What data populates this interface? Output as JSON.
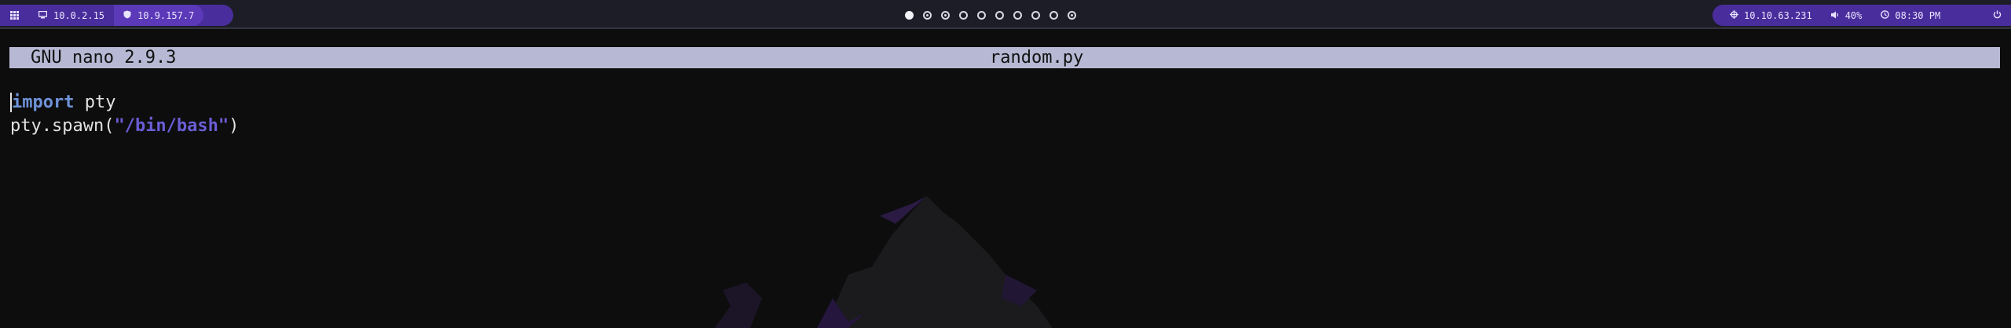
{
  "topbar": {
    "left": {
      "apps_icon": "grid-icon",
      "ip_local": "10.0.2.15",
      "ip_vpn": "10.9.157.7"
    },
    "workspaces": {
      "count": 10,
      "active_index": 0
    },
    "right": {
      "target_ip": "10.10.63.231",
      "volume": "40%",
      "time": "08:30 PM"
    }
  },
  "nano": {
    "version": "GNU nano 2.9.3",
    "filename": "random.py",
    "lines": [
      {
        "kw": "import",
        "rest": " pty"
      },
      {
        "pre": "pty.spawn(",
        "str": "\"/bin/bash\"",
        "post": ")"
      }
    ]
  },
  "colors": {
    "bar_bg": "#1c1d26",
    "pill": "#4a2d9c",
    "nano_bar": "#b7b9d4",
    "keyword": "#6f93d8",
    "string": "#6a5ed6"
  }
}
